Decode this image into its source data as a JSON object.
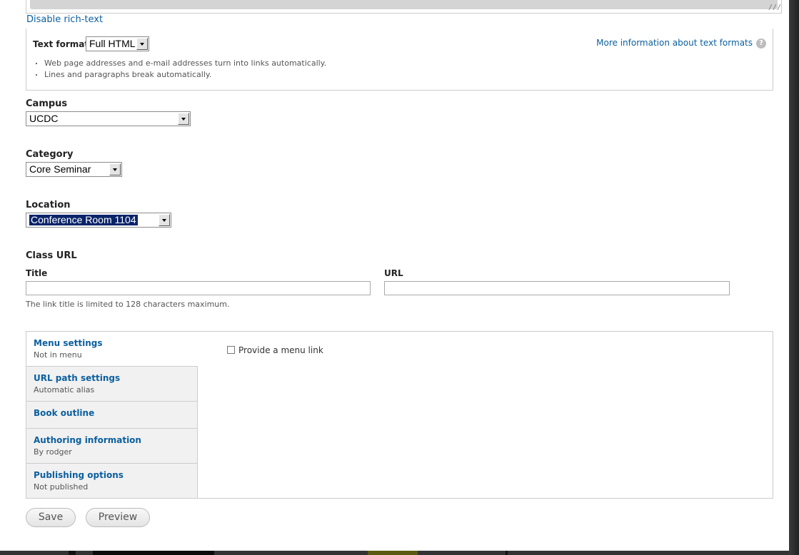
{
  "editor": {
    "disable_rich_text": "Disable rich-text",
    "resize_glyph": "///"
  },
  "text_format": {
    "label": "Text format",
    "selected": "Full HTML",
    "more_info": "More information about text formats",
    "help_glyph": "?",
    "tips": [
      "Web page addresses and e-mail addresses turn into links automatically.",
      "Lines and paragraphs break automatically."
    ]
  },
  "campus": {
    "label": "Campus",
    "selected": "UCDC"
  },
  "category": {
    "label": "Category",
    "selected": "Core Seminar"
  },
  "location": {
    "label": "Location",
    "selected": "Conference Room 1104"
  },
  "class_url": {
    "label": "Class URL",
    "title_label": "Title",
    "url_label": "URL",
    "title_value": "",
    "url_value": "",
    "description": "The link title is limited to 128 characters maximum."
  },
  "vertical_tabs": {
    "tabs": [
      {
        "title": "Menu settings",
        "summary": "Not in menu"
      },
      {
        "title": "URL path settings",
        "summary": "Automatic alias"
      },
      {
        "title": "Book outline",
        "summary": ""
      },
      {
        "title": "Authoring information",
        "summary": "By rodger"
      },
      {
        "title": "Publishing options",
        "summary": "Not published"
      }
    ],
    "menu_link_label": "Provide a menu link"
  },
  "actions": {
    "save": "Save",
    "preview": "Preview"
  }
}
